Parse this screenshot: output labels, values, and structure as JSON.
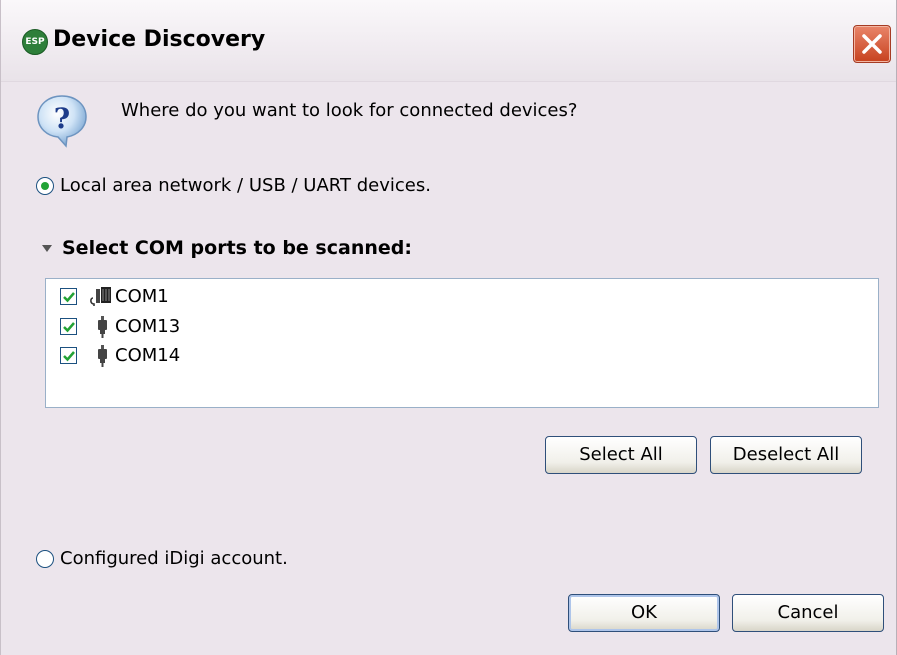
{
  "window": {
    "title": "Device Discovery",
    "app_icon_text": "ESP"
  },
  "prompt": {
    "text": "Where do you want to look for connected devices?"
  },
  "options": {
    "local": {
      "label": "Local area network / USB / UART devices.",
      "selected": true
    },
    "idigi": {
      "label": "Configured iDigi account.",
      "selected": false
    }
  },
  "com_section": {
    "header": "Select COM ports to be scanned:",
    "ports": [
      {
        "label": "COM1",
        "checked": true,
        "icon": "serial-port-icon"
      },
      {
        "label": "COM13",
        "checked": true,
        "icon": "usb-plug-icon"
      },
      {
        "label": "COM14",
        "checked": true,
        "icon": "usb-plug-icon"
      }
    ]
  },
  "buttons": {
    "select_all": "Select All",
    "deselect_all": "Deselect All",
    "ok": "OK",
    "cancel": "Cancel"
  },
  "colors": {
    "title_close_accent": "#d04a2a",
    "radio_selected": "#22a335",
    "check_mark": "#22a335"
  }
}
